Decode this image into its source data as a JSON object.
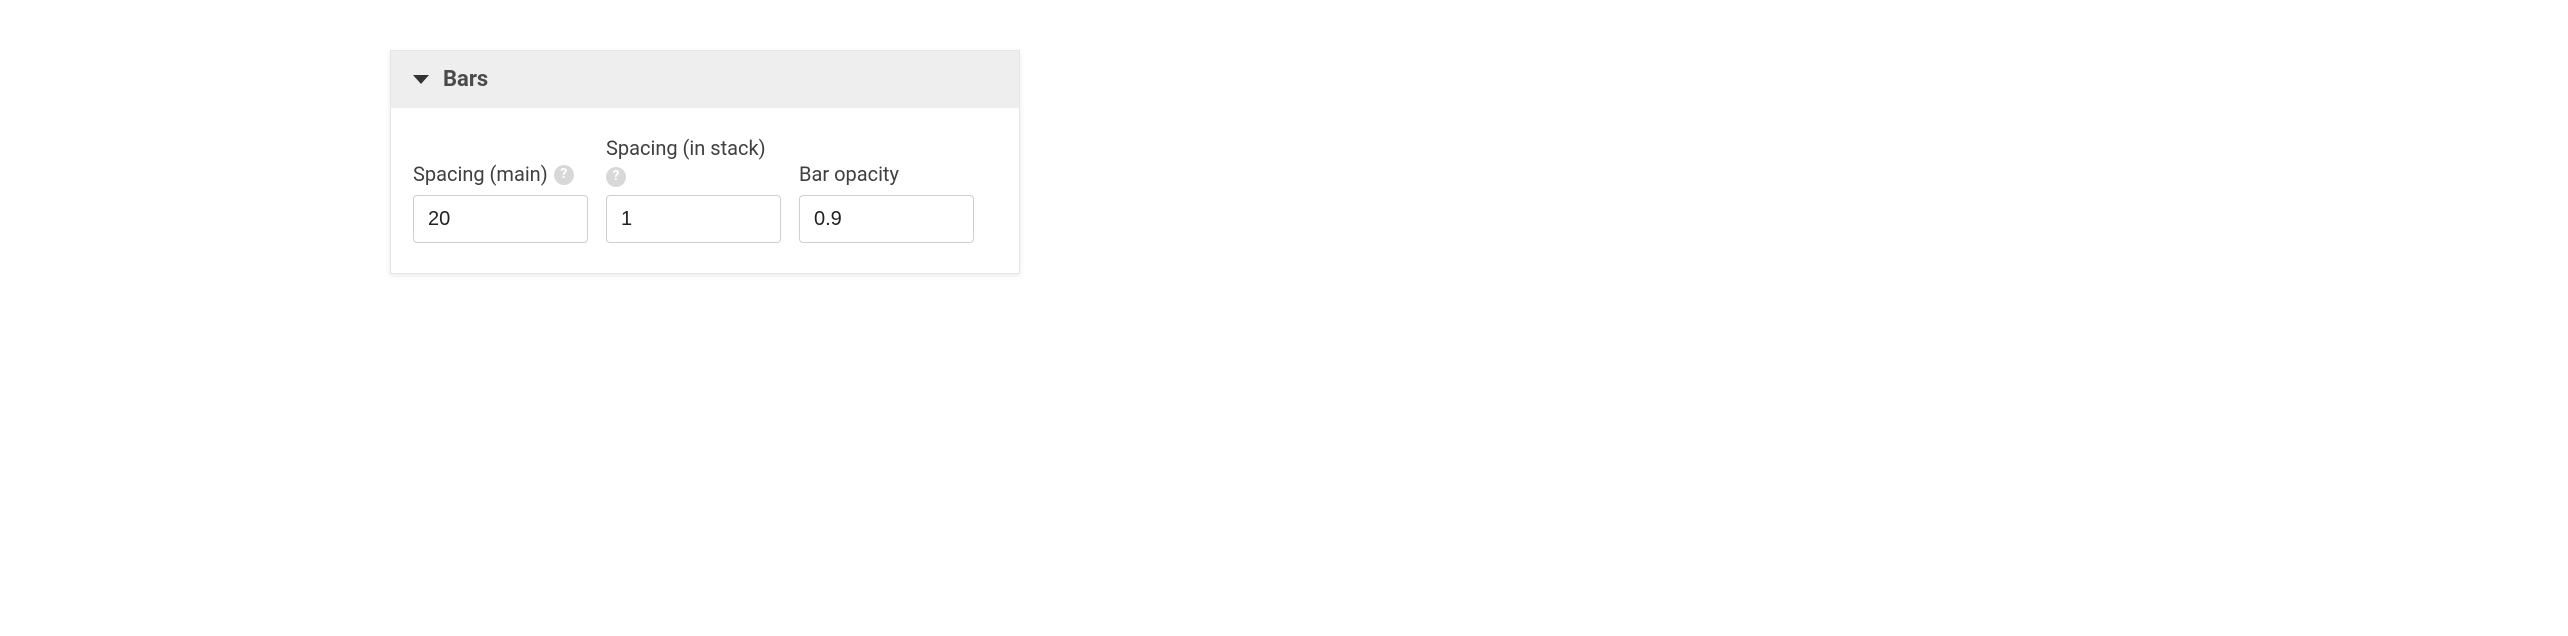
{
  "panel": {
    "title": "Bars",
    "fields": {
      "spacing_main": {
        "label": "Spacing (main)",
        "has_help": true,
        "value": "20"
      },
      "spacing_stack": {
        "label": "Spacing (in stack)",
        "has_help": true,
        "value": "1"
      },
      "bar_opacity": {
        "label": "Bar opacity",
        "has_help": false,
        "value": "0.9"
      }
    }
  }
}
